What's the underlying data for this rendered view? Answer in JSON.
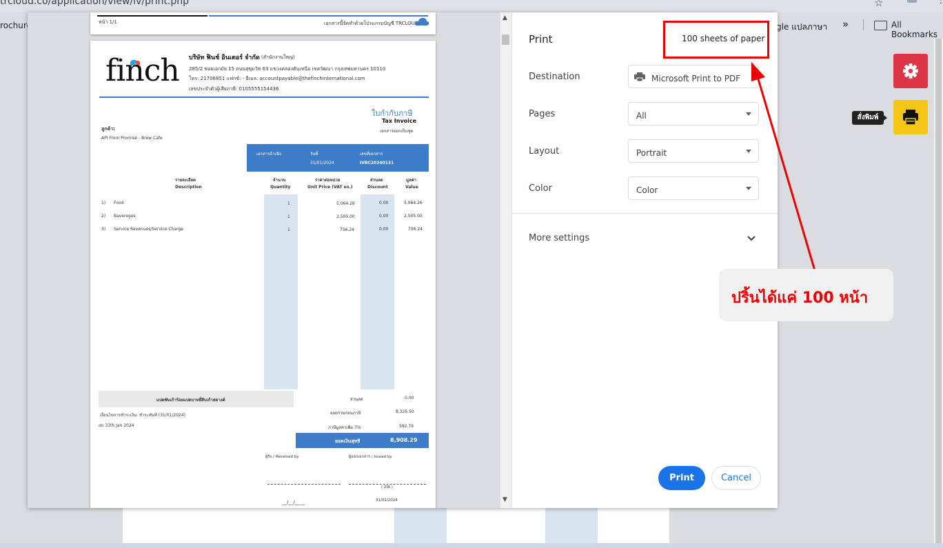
{
  "browser": {
    "url": "trcloud.co/application/view/iv/print.php",
    "bookmarks": {
      "left_partial": "rochure:",
      "translate_partial": "gle แปลภาษา",
      "more": "»",
      "all_bookmarks": "All Bookmarks"
    }
  },
  "preview": {
    "page_header": {
      "page_num": "หน้า 1/1",
      "trcloud_note": "เอกสารนี้จัดทำด้วยโปรแกรมบัญชี TRCLOUD"
    },
    "invoice": {
      "logo": "finch",
      "company_name": "บริษัท ฟินช์ อินเตอร์ จำกัด",
      "branch": "(สำนักงานใหญ่)",
      "address": "285/2 ซอยเอกมัย 15 ถนนสุขุมวิท 63 แขวงคลองตันเหนือ เขตวัฒนา กรุงเทพมหานคร 10110",
      "contact": "โทร: 21706851 แฟกซ์: - อีเมล: accountpayable@thefinchinternational.com",
      "tax_id": "เลขประจำตัวผู้เสียภาษี: 0105555154436",
      "title_th": "ใบกำกับภาษี",
      "title_en": "Tax Invoice",
      "set_note": "เอกสารออกเป็นชุด",
      "customer_label": "ลูกค้า:",
      "customer_name": "API From Promise - Brew Cafe",
      "ref_label": "เอกสารอ้างอิง",
      "date_label": "วันที่",
      "date_value": "31/01/2024",
      "docno_label": "เลขที่เอกสาร",
      "docno_value": "IVBC20240131",
      "col_desc_th": "รายละเอียด",
      "col_desc_en": "Description",
      "col_qty_th": "จำนวน",
      "col_qty_en": "Quantity",
      "col_price_th": "ราคาต่อหน่วย",
      "col_price_en": "Unit Price (VAT ex.)",
      "col_disc_th": "ส่วนลด",
      "col_disc_en": "Discount",
      "col_val_th": "มูลค่า",
      "col_val_en": "Value",
      "items": [
        {
          "no": "1)",
          "desc": "Food",
          "qty": "1",
          "price": "5,064.26",
          "disc": "0.00",
          "value": "5,064.26"
        },
        {
          "no": "2)",
          "desc": "Bavereges",
          "qty": "1",
          "price": "2,505.00",
          "disc": "0.00",
          "value": "2,505.00"
        },
        {
          "no": "3)",
          "desc": "Service Revenues/Service Charge",
          "qty": "1",
          "price": "756.24",
          "disc": "0.00",
          "value": "756.24"
        }
      ],
      "amount_words": "แปดพันเก้าร้อยแปดบาทยี่สิบเก้าสตางค์",
      "payment_note": "เงื่อนไขการชำระเงิน: ชำระทันที (31/01/2024)",
      "date_note": "on 31th Jan 2024",
      "discount_label": "ส่วนลด",
      "discount_value": "0.00",
      "subtotal_label": "ยอดรวมก่อนภาษี",
      "subtotal_value": "8,325.50",
      "vat_label": "ภาษีมูลค่าเพิ่ม 7%",
      "vat_value": "582.79",
      "net_label": "ยอดเงินสุทธิ",
      "net_value": "8,908.29",
      "received_by": "ผู้รับ / Received by",
      "issued_by": "ผู้ออกเอกสาร / Issued by",
      "sig_issuer": "( ZIA )",
      "sig_date": "31/01/2024",
      "sig_blank_date": "__/__/____"
    }
  },
  "print": {
    "title": "Print",
    "sheets": "100 sheets of paper",
    "destination_label": "Destination",
    "destination_value": "Microsoft Print to PDF",
    "pages_label": "Pages",
    "pages_value": "All",
    "layout_label": "Layout",
    "layout_value": "Portrait",
    "color_label": "Color",
    "color_value": "Color",
    "more_settings": "More settings",
    "print_button": "Print",
    "cancel_button": "Cancel"
  },
  "annotation": {
    "callout_text": "ปริ้นได้แค่ 100 หน้า"
  },
  "side_buttons": {
    "tooltip": "สั่งพิมพ์"
  },
  "colors": {
    "accent_blue": "#1a73e8",
    "invoice_blue": "#3d7cc9",
    "annotation_red": "#e00000",
    "gear_button": "#dc3545",
    "printer_button": "#f5c518"
  }
}
